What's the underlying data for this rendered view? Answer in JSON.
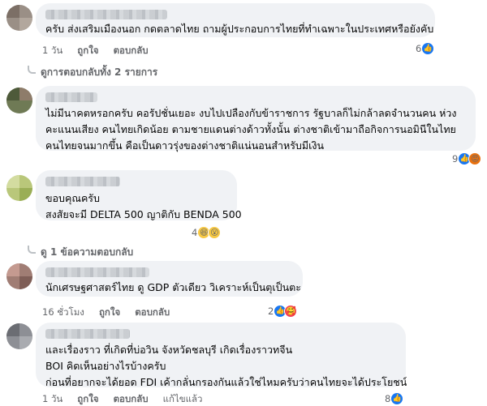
{
  "actions": {
    "like": "ถูกใจ",
    "reply": "ตอบกลับ",
    "edit": "แก้ไขแล้ว"
  },
  "comments": [
    {
      "text_lines": [
        "ครับ ส่งเสริมเมืองนอก กดตลาดไทย ถามผู้ประกอบการไทยที่ทำเฉพาะในประเทศหรือยังคับ"
      ],
      "time": "1 วัน",
      "reactions": {
        "count": "6",
        "icons": [
          "like-icon"
        ]
      },
      "replies_label": "ดูการตอบกลับทั้ง 2 รายการ"
    },
    {
      "text_lines": [
        "ไม่มีนาคตหรอกครับ คอรัปชั่นเยอะ งบไปเปลืองกับข้าราชการ รัฐบาลก็ไม่กล้าลดจำนวนคน ห่วง",
        "คะแนนเสียง คนไทยเกิดน้อย ตามชายแดนต่างด้าวทั้งนั้น ต่างชาติเข้ามาถือกิจการนอมินีในไทย",
        "คนไทยจนมากขึ้น คือเป็นดาวรุ่งของต่างชาติแน่นอนสำหรับมีเงิน"
      ],
      "reactions": {
        "count": "9",
        "icons": [
          "like-icon",
          "angry-icon"
        ]
      }
    },
    {
      "text_lines": [
        "ขอบคุณครับ",
        "สงสัยจะมี DELTA 500 ญาติกับ BENDA 500"
      ],
      "reactions": {
        "count": "4",
        "icons": [
          "haha-icon",
          "wow-icon"
        ]
      },
      "replies_label": "ดู 1 ข้อความตอบกลับ"
    },
    {
      "text_lines": [
        "นักเศรษฐศาสตร์ไทย ดู GDP ตัวเดียว วิเคราะห์เป็นตุเป็นตะ"
      ],
      "time": "16 ชั่วโมง",
      "reactions": {
        "count": "2",
        "icons": [
          "like-icon",
          "love-icon"
        ]
      }
    },
    {
      "text_lines": [
        "และเรื่องราว ที่เกิดที่บ่อวิน จังหวัดชลบุรี เกิดเรื่องราวทจีน",
        "BOI คิดเห็นอย่างไรบ้างครับ",
        "ก่อนที่อยากจะได้ยอด FDI เค้ากลั่นกรองกันแล้วใช่ไหมครับว่าคนไทยจะได้ประโยชน์"
      ],
      "time": "1 วัน",
      "reactions": {
        "count": "8",
        "icons": [
          "like-icon"
        ]
      }
    }
  ]
}
